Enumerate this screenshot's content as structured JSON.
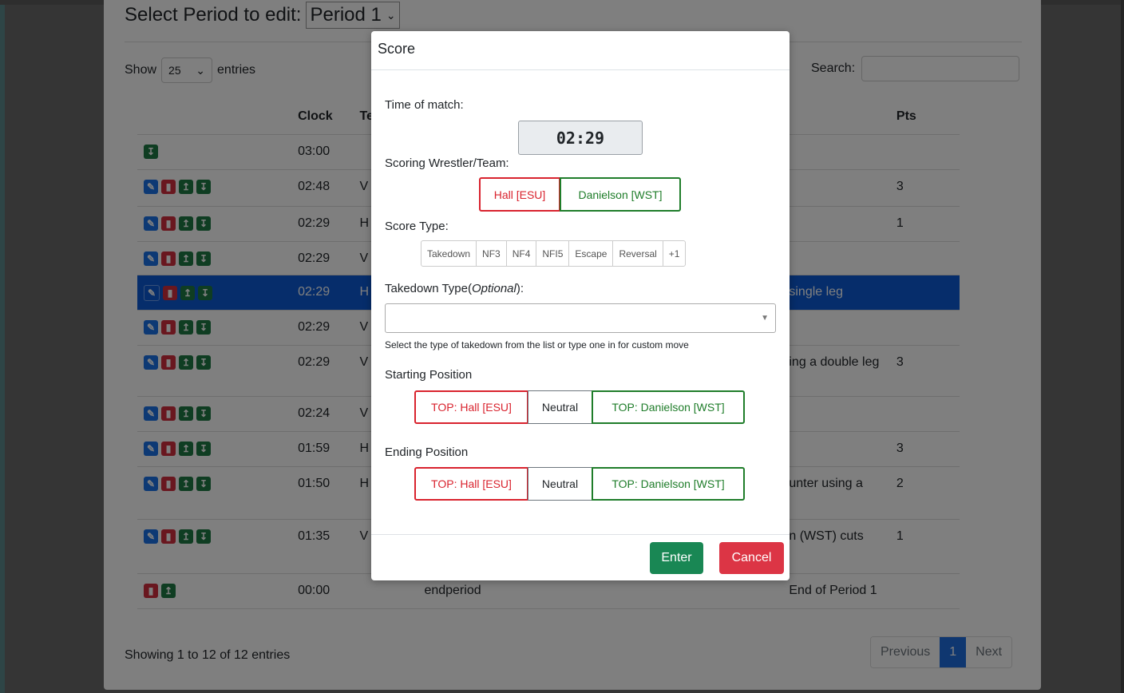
{
  "page": {
    "period_label": "Select Period to edit:",
    "period_value": "Period 1",
    "show_label": "Show",
    "show_value": "25",
    "entries_label": "entries",
    "search_label": "Search:",
    "columns": [
      "",
      "Clock",
      "Te",
      "",
      "",
      "Pts"
    ],
    "rows": [
      {
        "actions": [
          "down"
        ],
        "clock": "03:00",
        "team": "",
        "type": "",
        "desc": "",
        "pts": ""
      },
      {
        "actions": [
          "edit",
          "delete",
          "up",
          "down"
        ],
        "clock": "02:48",
        "team": "V",
        "type": "",
        "desc": "",
        "pts": "3"
      },
      {
        "actions": [
          "edit",
          "delete",
          "up",
          "down"
        ],
        "clock": "02:29",
        "team": "H",
        "type": "",
        "desc": "",
        "pts": "1"
      },
      {
        "actions": [
          "edit",
          "delete",
          "up",
          "down"
        ],
        "clock": "02:29",
        "team": "V",
        "type": "",
        "desc": "",
        "pts": ""
      },
      {
        "actions": [
          "edit",
          "delete",
          "up",
          "down"
        ],
        "clock": "02:29",
        "team": "H",
        "type": "",
        "desc": "single leg",
        "pts": "",
        "selected": true
      },
      {
        "actions": [
          "edit",
          "delete",
          "up",
          "down"
        ],
        "clock": "02:29",
        "team": "V",
        "type": "",
        "desc": "",
        "pts": ""
      },
      {
        "actions": [
          "edit",
          "delete",
          "up",
          "down"
        ],
        "clock": "02:29",
        "team": "V",
        "type": "",
        "desc": "ing a double leg",
        "pts": "3"
      },
      {
        "actions": [
          "edit",
          "delete",
          "up",
          "down"
        ],
        "clock": "02:24",
        "team": "V",
        "type": "",
        "desc": "",
        "pts": ""
      },
      {
        "actions": [
          "edit",
          "delete",
          "up",
          "down"
        ],
        "clock": "01:59",
        "team": "H",
        "type": "",
        "desc": "",
        "pts": "3"
      },
      {
        "actions": [
          "edit",
          "delete",
          "up",
          "down"
        ],
        "clock": "01:50",
        "team": "H",
        "type": "",
        "desc": "unter using a",
        "pts": "2"
      },
      {
        "actions": [
          "edit",
          "delete",
          "up",
          "down"
        ],
        "clock": "01:35",
        "team": "V",
        "type": "",
        "desc": "n (WST) cuts",
        "pts": "1"
      },
      {
        "actions": [
          "delete",
          "up"
        ],
        "clock": "00:00",
        "team": "",
        "type": "endperiod",
        "desc": "End of Period 1",
        "pts": ""
      }
    ],
    "info": "Showing 1 to 12 of 12 entries",
    "pager": {
      "previous": "Previous",
      "current": "1",
      "next": "Next"
    }
  },
  "modal": {
    "title": "Score",
    "time_label": "Time of match:",
    "time_value": "02:29",
    "scoring_label": "Scoring Wrestler/Team:",
    "wrestler_red": "Hall [ESU]",
    "wrestler_green": "Danielson [WST]",
    "score_type_label": "Score Type:",
    "score_types": [
      "Takedown",
      "NF3",
      "NF4",
      "NFI5",
      "Escape",
      "Reversal",
      "+1"
    ],
    "takedown_label": "Takedown Type(",
    "takedown_optional": "Optional",
    "takedown_close": "):",
    "takedown_help": "Select the type of takedown from the list or type one in for custom move",
    "starting_label": "Starting Position",
    "ending_label": "Ending Position",
    "pos_red": "TOP: Hall [ESU]",
    "pos_neutral": "Neutral",
    "pos_green": "TOP: Danielson [WST]",
    "enter": "Enter",
    "cancel": "Cancel"
  },
  "colors": {
    "selected_row": "#0d5bd6",
    "red": "#d9232e",
    "green": "#1f7d2a",
    "enter": "#198754",
    "cancel": "#dc3545"
  }
}
